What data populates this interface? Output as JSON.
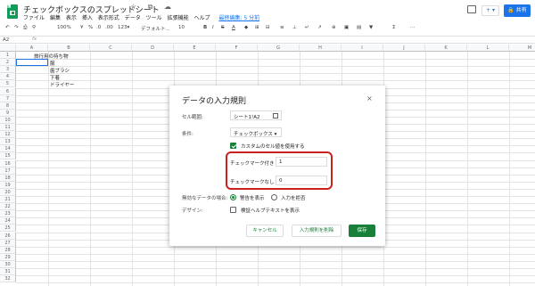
{
  "header": {
    "title": "チェックボックスのスプレッドシート",
    "title_icons": "☆ ⧉ ☁",
    "menus": [
      "ファイル",
      "編集",
      "表示",
      "挿入",
      "表示形式",
      "データ",
      "ツール",
      "拡張機能",
      "ヘルプ"
    ],
    "last_edit": "最終編集: 5 分前",
    "share_label": "共有",
    "present_label": "+ ▾"
  },
  "toolbar": {
    "undo": "↶",
    "redo": "↷",
    "print": "⎙",
    "paint": "⚲",
    "zoom": "100%",
    "currency": "¥",
    "percent": "%",
    "decimal_less": ".0",
    "decimal_more": ".00",
    "more_formats": "123▾",
    "font": "デフォルト...",
    "font_size": "10",
    "bold": "B",
    "italic": "I",
    "strike": "S",
    "text_color": "A",
    "fill": "◆",
    "borders": "⊞",
    "merge": "⊟",
    "align": "≡",
    "valign": "⊥",
    "wrap": "↵",
    "rotate": "↗",
    "link": "⊕",
    "comment": "▣",
    "chart": "▤",
    "filter": "▼",
    "functions": "Σ",
    "more": "⋯"
  },
  "formula_bar": {
    "cell_ref": "A2",
    "fx": "fx"
  },
  "sheet": {
    "columns": [
      "A",
      "B",
      "C",
      "D",
      "E",
      "F",
      "G",
      "H",
      "I",
      "J",
      "K",
      "L",
      "M"
    ],
    "rows": [
      "1",
      "2",
      "3",
      "4",
      "5",
      "6",
      "7",
      "8",
      "9",
      "10",
      "11",
      "12",
      "13",
      "14",
      "15",
      "16",
      "17",
      "18",
      "19",
      "20",
      "21",
      "22",
      "23",
      "24",
      "25",
      "26",
      "27",
      "28",
      "29",
      "30",
      "31",
      "32"
    ],
    "cells": {
      "A1": "旅行用の持ち物",
      "B2": "服",
      "B3": "歯ブラシ",
      "B4": "下着",
      "B5": "ドライヤー"
    }
  },
  "dialog": {
    "title": "データの入力規則",
    "close": "×",
    "range_label": "セル範囲:",
    "range_value": "シート1!A2",
    "criteria_label": "条件:",
    "criteria_value": "チェックボックス ▾",
    "custom_values_label": "カスタムのセル値を使用する",
    "custom_values_checked": true,
    "checked_label": "チェックマーク付き",
    "checked_value": "1",
    "unchecked_label": "チェックマークなし",
    "unchecked_value": "0",
    "invalid_label": "無効なデータの場合:",
    "invalid_options": [
      "警告を表示",
      "入力を拒否"
    ],
    "invalid_selected": "警告を表示",
    "appearance_label": "デザイン:",
    "help_text_label": "検証ヘルプテキストを表示",
    "cancel_label": "キャンセル",
    "delete_label": "入力規則を削除",
    "save_label": "保存"
  },
  "colors": {
    "brand_green": "#188038",
    "accent_blue": "#1a73e8",
    "highlight_red": "#c9211e"
  }
}
